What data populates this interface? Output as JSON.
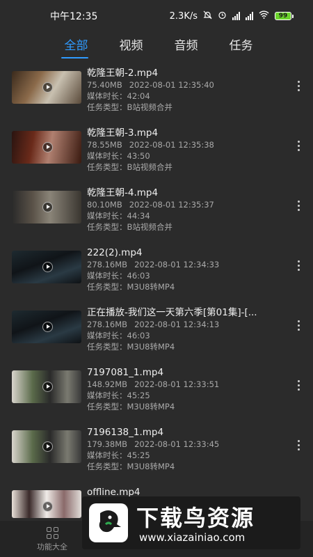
{
  "status_bar": {
    "time": "中午12:35",
    "speed": "2.3K/s",
    "battery": "99"
  },
  "tabs": [
    {
      "label": "全部",
      "active": true
    },
    {
      "label": "视频",
      "active": false
    },
    {
      "label": "音频",
      "active": false
    },
    {
      "label": "任务",
      "active": false
    }
  ],
  "items": [
    {
      "title": "乾隆王朝-2.mp4",
      "size": "75.40MB",
      "date": "2022-08-01 12:35:40",
      "duration_label": "媒体时长：",
      "duration": "42:04",
      "type_label": "任务类型：",
      "type": "B站视频合并"
    },
    {
      "title": "乾隆王朝-3.mp4",
      "size": "78.55MB",
      "date": "2022-08-01 12:35:38",
      "duration_label": "媒体时长：",
      "duration": "43:50",
      "type_label": "任务类型：",
      "type": "B站视频合并"
    },
    {
      "title": "乾隆王朝-4.mp4",
      "size": "80.10MB",
      "date": "2022-08-01 12:35:37",
      "duration_label": "媒体时长：",
      "duration": "44:34",
      "type_label": "任务类型：",
      "type": "B站视频合并"
    },
    {
      "title": "222(2).mp4",
      "size": "278.16MB",
      "date": "2022-08-01 12:34:33",
      "duration_label": "媒体时长：",
      "duration": "46:03",
      "type_label": "任务类型：",
      "type": "M3U8转MP4"
    },
    {
      "title": "正在播放-我们这一天第六季[第01集]-[...",
      "size": "278.16MB",
      "date": "2022-08-01 12:34:13",
      "duration_label": "媒体时长：",
      "duration": "46:03",
      "type_label": "任务类型：",
      "type": "M3U8转MP4"
    },
    {
      "title": "7197081_1.mp4",
      "size": "148.92MB",
      "date": "2022-08-01 12:33:51",
      "duration_label": "媒体时长：",
      "duration": "45:25",
      "type_label": "任务类型：",
      "type": "M3U8转MP4"
    },
    {
      "title": "7196138_1.mp4",
      "size": "179.38MB",
      "date": "2022-08-01 12:33:45",
      "duration_label": "媒体时长：",
      "duration": "45:25",
      "type_label": "任务类型：",
      "type": "M3U8转MP4"
    },
    {
      "title": "offline.mp4",
      "size": "",
      "date": "",
      "duration_label": "",
      "duration": "",
      "type_label": "",
      "type": ""
    }
  ],
  "bottom_nav": {
    "features_label": "功能大全"
  },
  "watermark": {
    "title": "下载鸟资源",
    "url": "www.xiazainiao.com"
  },
  "colors": {
    "accent": "#2f9bff",
    "background": "#2b2b2b",
    "battery": "#6cd42c"
  }
}
